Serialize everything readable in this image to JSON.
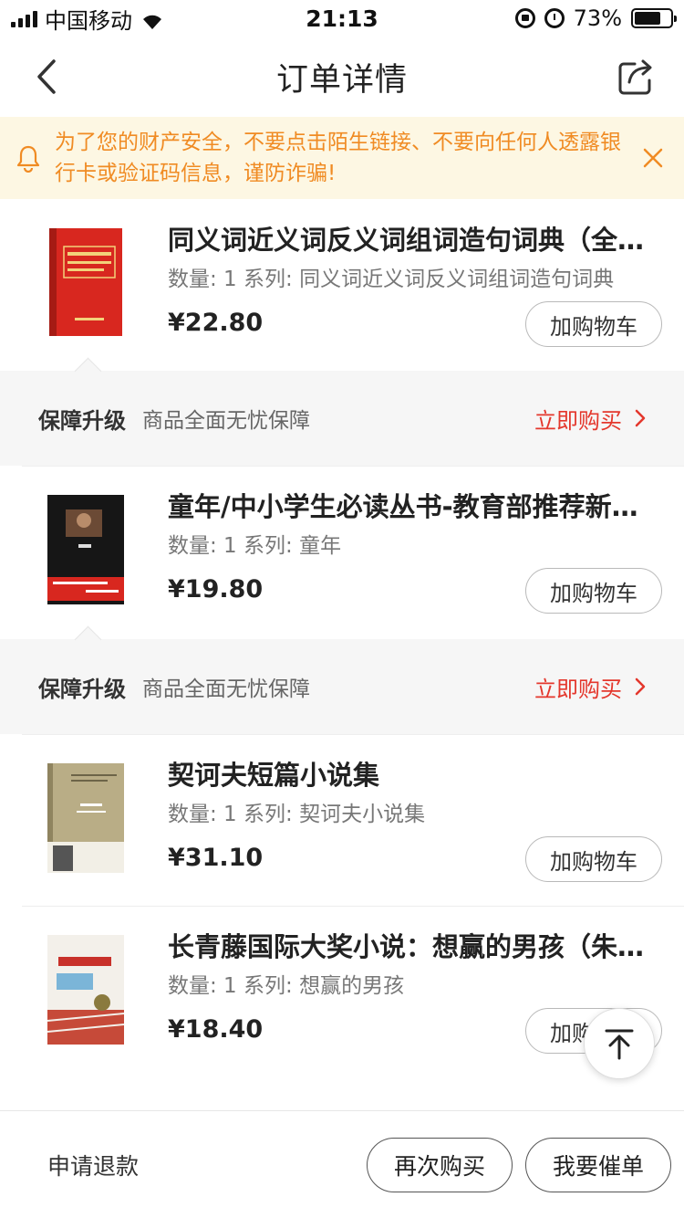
{
  "status_bar": {
    "carrier": "中国移动",
    "time": "21:13",
    "battery_percent": "73%",
    "battery_level": 0.73
  },
  "nav": {
    "title": "订单详情"
  },
  "notice": {
    "text": "为了您的财产安全，不要点击陌生链接、不要向任何人透露银行卡或验证码信息，谨防诈骗!"
  },
  "products": [
    {
      "title": "同义词近义词反义词组词造句词典（全新版）",
      "meta": "数量: 1 系列: 同义词近义词反义词组词造句词典",
      "price": "¥22.80",
      "cart_label": "加购物车",
      "cover_color": "#d8271f"
    },
    {
      "title": "童年/中小学生必读丛书-教育部推荐新课标",
      "meta": "数量: 1 系列: 童年",
      "price": "¥19.80",
      "cart_label": "加购物车",
      "cover_color": "#1a1a1a"
    },
    {
      "title": "契诃夫短篇小说集",
      "meta": "数量: 1 系列: 契诃夫小说集",
      "price": "¥31.10",
      "cart_label": "加购物车",
      "cover_color": "#b9ad86"
    },
    {
      "title": "长青藤国际大奖小说：想赢的男孩（朱自强）",
      "meta": "数量: 1 系列: 想赢的男孩",
      "price": "¥18.40",
      "cart_label": "加购物车",
      "cover_color": "#f3f0ea"
    }
  ],
  "guarantee": {
    "title": "保障升级",
    "desc": "商品全面无忧保障",
    "action": "立即购买"
  },
  "bottom": {
    "refund": "申请退款",
    "rebuy": "再次购买",
    "urge": "我要催单"
  },
  "colors": {
    "accent_red": "#e4372c",
    "notice_orange": "#f08b23",
    "notice_bg": "#fdf7e3"
  }
}
